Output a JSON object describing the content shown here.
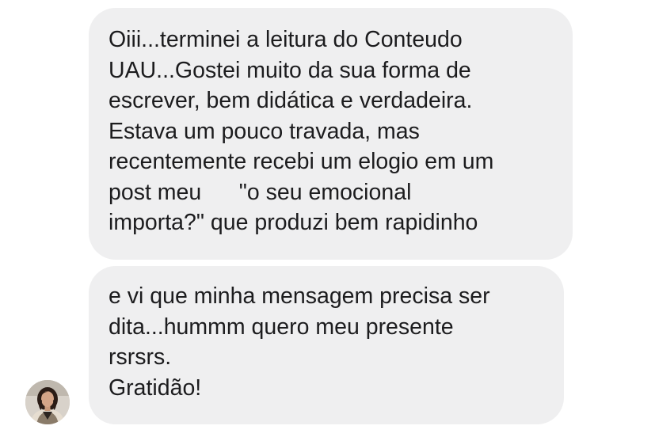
{
  "messages": [
    {
      "lines": [
        "Oiii...terminei a leitura do Conteudo",
        "UAU...Gostei muito da sua forma de",
        "escrever, bem didática e verdadeira.",
        "Estava um pouco travada, mas",
        "recentemente recebi um elogio em um",
        "post meu      \"o seu emocional",
        "importa?\" que produzi bem rapidinho"
      ]
    },
    {
      "lines": [
        "e vi que minha mensagem precisa ser",
        "dita...hummm quero meu presente",
        "rsrsrs.",
        "Gratidão!"
      ]
    }
  ],
  "colors": {
    "bubble_background": "#efeff0",
    "text": "#1c1c1e",
    "page_background": "#ffffff"
  },
  "sender": {
    "avatar_icon": "user-photo-avatar"
  }
}
